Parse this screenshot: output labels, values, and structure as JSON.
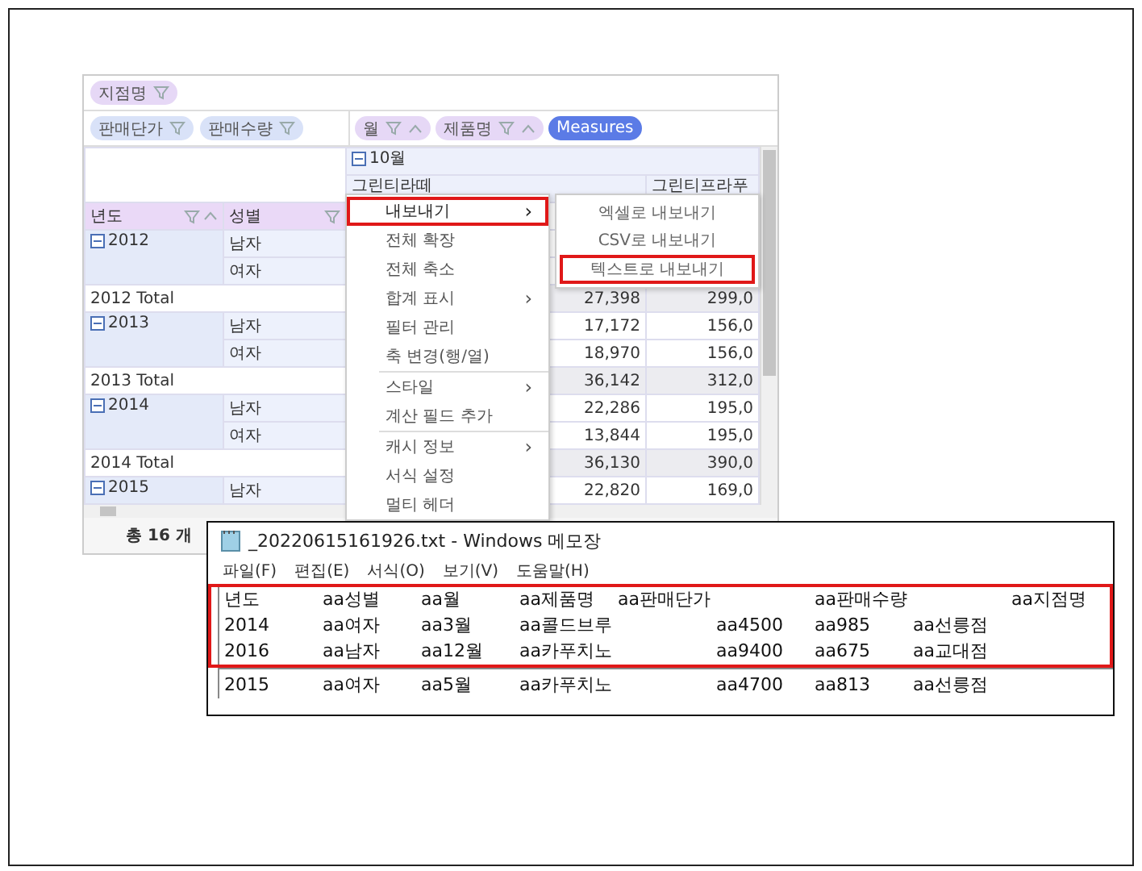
{
  "pivot": {
    "filter_chips": [
      {
        "label": "지점명"
      }
    ],
    "value_chips": [
      {
        "label": "판매단가"
      },
      {
        "label": "판매수량"
      }
    ],
    "column_chips": [
      {
        "label": "월",
        "kind": "field"
      },
      {
        "label": "제품명",
        "kind": "field"
      },
      {
        "label": "Measures",
        "kind": "measures"
      }
    ],
    "column_group": "10월",
    "column_headers": [
      "그린티라떼",
      "그린티프라푸"
    ],
    "row_headers": [
      {
        "label": "년도",
        "sort": true
      },
      {
        "label": "성별",
        "sort": false
      }
    ],
    "rows": [
      {
        "kind": "member",
        "year": "2012",
        "gender": "남자",
        "values": []
      },
      {
        "kind": "member",
        "gender": "여자",
        "values": []
      },
      {
        "kind": "total",
        "label": "2012 Total",
        "values": [
          "27,398",
          "299,0"
        ]
      },
      {
        "kind": "member",
        "year": "2013",
        "gender": "남자",
        "values": [
          "17,172",
          "156,0"
        ]
      },
      {
        "kind": "member",
        "gender": "여자",
        "values": [
          "18,970",
          "156,0"
        ]
      },
      {
        "kind": "total",
        "label": "2013 Total",
        "values": [
          "36,142",
          "312,0"
        ]
      },
      {
        "kind": "member",
        "year": "2014",
        "gender": "남자",
        "values": [
          "22,286",
          "195,0"
        ]
      },
      {
        "kind": "member",
        "gender": "여자",
        "values": [
          "13,844",
          "195,0"
        ]
      },
      {
        "kind": "total",
        "label": "2014 Total",
        "values": [
          "36,130",
          "390,0"
        ]
      },
      {
        "kind": "member",
        "year": "2015",
        "gender": "남자",
        "values": [
          "22,820",
          "169,0"
        ]
      }
    ],
    "footer": "총 16 개"
  },
  "context_menu": {
    "items": [
      {
        "label": "내보내기",
        "arrow": "›",
        "highlighted": true,
        "separator_before": false
      },
      {
        "label": "전체 확장",
        "highlighted": false,
        "separator_before": false
      },
      {
        "label": "전체 축소",
        "highlighted": false,
        "separator_before": false
      },
      {
        "label": "합계 표시",
        "arrow": "›",
        "highlighted": false,
        "separator_before": false
      },
      {
        "label": "필터 관리",
        "highlighted": false,
        "separator_before": false
      },
      {
        "label": "축 변경(행/열)",
        "highlighted": false,
        "separator_before": false
      },
      {
        "label": "스타일",
        "arrow": "›",
        "highlighted": false,
        "separator_before": true
      },
      {
        "label": "계산 필드 추가",
        "highlighted": false,
        "separator_before": false
      },
      {
        "label": "캐시 정보",
        "arrow": "›",
        "highlighted": false,
        "separator_before": true
      },
      {
        "label": "서식 설정",
        "highlighted": false,
        "separator_before": false
      },
      {
        "label": "멀티 헤더",
        "highlighted": false,
        "separator_before": false
      }
    ]
  },
  "submenu": {
    "items": [
      {
        "label": "엑셀로 내보내기",
        "highlighted": false
      },
      {
        "label": "CSV로 내보내기",
        "highlighted": false
      },
      {
        "label": "텍스트로 내보내기",
        "highlighted": true
      }
    ]
  },
  "notepad": {
    "title": "_20220615161926.txt - Windows 메모장",
    "menu": [
      "파일(F)",
      "편집(E)",
      "서식(O)",
      "보기(V)",
      "도움말(H)"
    ],
    "lines": [
      {
        "text": "년도\taa성별\taa월\taa제품명\taa판매단가\t\taa판매수량\t\taa지점명",
        "highlighted": true
      },
      {
        "text": "2014\taa여자\taa3월\taa콜드브루\t\taa4500\taa985\taa선릉점",
        "highlighted": true
      },
      {
        "text": "2016\taa남자\taa12월\taa카푸치노\t\taa9400\taa675\taa교대점",
        "highlighted": true
      },
      {
        "text": "2015\taa여자\taa5월\taa카푸치노\t\taa4700\taa813\taa선릉점",
        "highlighted": false
      }
    ]
  }
}
